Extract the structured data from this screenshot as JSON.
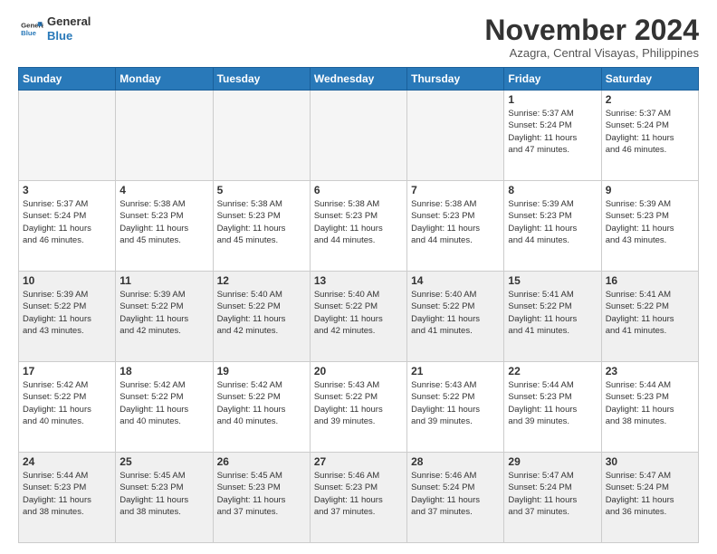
{
  "logo": {
    "line1": "General",
    "line2": "Blue"
  },
  "title": "November 2024",
  "location": "Azagra, Central Visayas, Philippines",
  "weekdays": [
    "Sunday",
    "Monday",
    "Tuesday",
    "Wednesday",
    "Thursday",
    "Friday",
    "Saturday"
  ],
  "weeks": [
    [
      {
        "day": "",
        "info": ""
      },
      {
        "day": "",
        "info": ""
      },
      {
        "day": "",
        "info": ""
      },
      {
        "day": "",
        "info": ""
      },
      {
        "day": "",
        "info": ""
      },
      {
        "day": "1",
        "info": "Sunrise: 5:37 AM\nSunset: 5:24 PM\nDaylight: 11 hours\nand 47 minutes."
      },
      {
        "day": "2",
        "info": "Sunrise: 5:37 AM\nSunset: 5:24 PM\nDaylight: 11 hours\nand 46 minutes."
      }
    ],
    [
      {
        "day": "3",
        "info": "Sunrise: 5:37 AM\nSunset: 5:24 PM\nDaylight: 11 hours\nand 46 minutes."
      },
      {
        "day": "4",
        "info": "Sunrise: 5:38 AM\nSunset: 5:23 PM\nDaylight: 11 hours\nand 45 minutes."
      },
      {
        "day": "5",
        "info": "Sunrise: 5:38 AM\nSunset: 5:23 PM\nDaylight: 11 hours\nand 45 minutes."
      },
      {
        "day": "6",
        "info": "Sunrise: 5:38 AM\nSunset: 5:23 PM\nDaylight: 11 hours\nand 44 minutes."
      },
      {
        "day": "7",
        "info": "Sunrise: 5:38 AM\nSunset: 5:23 PM\nDaylight: 11 hours\nand 44 minutes."
      },
      {
        "day": "8",
        "info": "Sunrise: 5:39 AM\nSunset: 5:23 PM\nDaylight: 11 hours\nand 44 minutes."
      },
      {
        "day": "9",
        "info": "Sunrise: 5:39 AM\nSunset: 5:23 PM\nDaylight: 11 hours\nand 43 minutes."
      }
    ],
    [
      {
        "day": "10",
        "info": "Sunrise: 5:39 AM\nSunset: 5:22 PM\nDaylight: 11 hours\nand 43 minutes."
      },
      {
        "day": "11",
        "info": "Sunrise: 5:39 AM\nSunset: 5:22 PM\nDaylight: 11 hours\nand 42 minutes."
      },
      {
        "day": "12",
        "info": "Sunrise: 5:40 AM\nSunset: 5:22 PM\nDaylight: 11 hours\nand 42 minutes."
      },
      {
        "day": "13",
        "info": "Sunrise: 5:40 AM\nSunset: 5:22 PM\nDaylight: 11 hours\nand 42 minutes."
      },
      {
        "day": "14",
        "info": "Sunrise: 5:40 AM\nSunset: 5:22 PM\nDaylight: 11 hours\nand 41 minutes."
      },
      {
        "day": "15",
        "info": "Sunrise: 5:41 AM\nSunset: 5:22 PM\nDaylight: 11 hours\nand 41 minutes."
      },
      {
        "day": "16",
        "info": "Sunrise: 5:41 AM\nSunset: 5:22 PM\nDaylight: 11 hours\nand 41 minutes."
      }
    ],
    [
      {
        "day": "17",
        "info": "Sunrise: 5:42 AM\nSunset: 5:22 PM\nDaylight: 11 hours\nand 40 minutes."
      },
      {
        "day": "18",
        "info": "Sunrise: 5:42 AM\nSunset: 5:22 PM\nDaylight: 11 hours\nand 40 minutes."
      },
      {
        "day": "19",
        "info": "Sunrise: 5:42 AM\nSunset: 5:22 PM\nDaylight: 11 hours\nand 40 minutes."
      },
      {
        "day": "20",
        "info": "Sunrise: 5:43 AM\nSunset: 5:22 PM\nDaylight: 11 hours\nand 39 minutes."
      },
      {
        "day": "21",
        "info": "Sunrise: 5:43 AM\nSunset: 5:22 PM\nDaylight: 11 hours\nand 39 minutes."
      },
      {
        "day": "22",
        "info": "Sunrise: 5:44 AM\nSunset: 5:23 PM\nDaylight: 11 hours\nand 39 minutes."
      },
      {
        "day": "23",
        "info": "Sunrise: 5:44 AM\nSunset: 5:23 PM\nDaylight: 11 hours\nand 38 minutes."
      }
    ],
    [
      {
        "day": "24",
        "info": "Sunrise: 5:44 AM\nSunset: 5:23 PM\nDaylight: 11 hours\nand 38 minutes."
      },
      {
        "day": "25",
        "info": "Sunrise: 5:45 AM\nSunset: 5:23 PM\nDaylight: 11 hours\nand 38 minutes."
      },
      {
        "day": "26",
        "info": "Sunrise: 5:45 AM\nSunset: 5:23 PM\nDaylight: 11 hours\nand 37 minutes."
      },
      {
        "day": "27",
        "info": "Sunrise: 5:46 AM\nSunset: 5:23 PM\nDaylight: 11 hours\nand 37 minutes."
      },
      {
        "day": "28",
        "info": "Sunrise: 5:46 AM\nSunset: 5:24 PM\nDaylight: 11 hours\nand 37 minutes."
      },
      {
        "day": "29",
        "info": "Sunrise: 5:47 AM\nSunset: 5:24 PM\nDaylight: 11 hours\nand 37 minutes."
      },
      {
        "day": "30",
        "info": "Sunrise: 5:47 AM\nSunset: 5:24 PM\nDaylight: 11 hours\nand 36 minutes."
      }
    ]
  ]
}
